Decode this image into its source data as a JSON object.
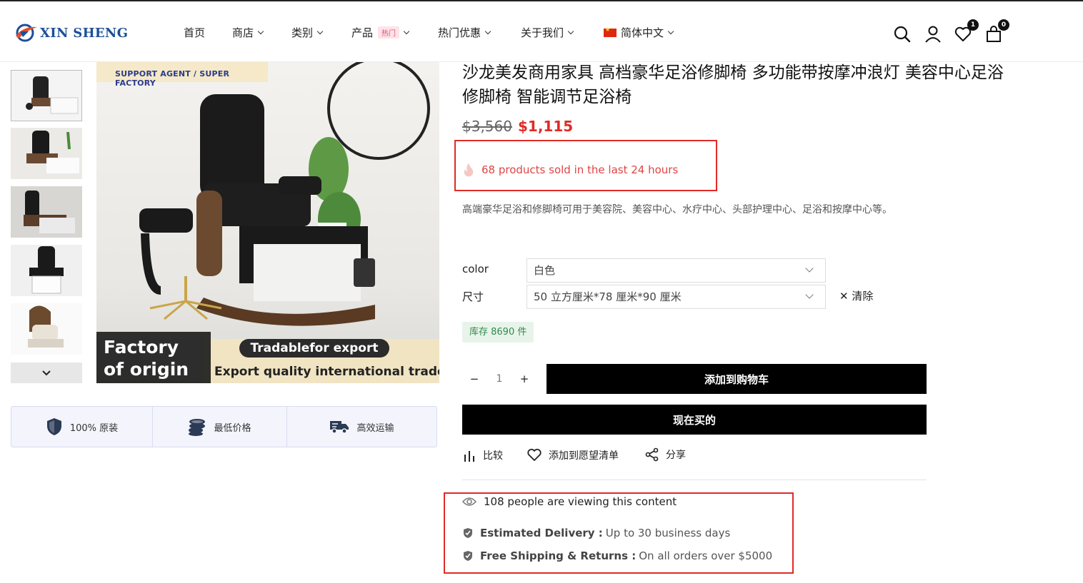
{
  "brand": {
    "name": "XIN SHENG"
  },
  "nav": [
    {
      "label": "首页",
      "has_dropdown": false
    },
    {
      "label": "商店",
      "has_dropdown": true
    },
    {
      "label": "类别",
      "has_dropdown": true
    },
    {
      "label": "产品",
      "has_dropdown": true,
      "badge": "热门"
    },
    {
      "label": "热门优惠",
      "has_dropdown": true
    },
    {
      "label": "关于我们",
      "has_dropdown": true
    },
    {
      "label": "简体中文",
      "has_dropdown": true,
      "icon": "china-flag-icon"
    }
  ],
  "header_icons": {
    "search": "search-icon",
    "account": "user-icon",
    "wishlist_count": "1",
    "cart_count": "0"
  },
  "gallery": {
    "banner_top": "SUPPORT AGENT / SUPER FACTORY",
    "factory_line1": "Factory",
    "factory_line2": "of origin",
    "trade_pill": "Tradablefor export",
    "trade_line": "Export quality international trade",
    "thumbnail_count": 5
  },
  "features": [
    {
      "label": "100% 原装",
      "icon": "shield-icon"
    },
    {
      "label": "最低价格",
      "icon": "coins-icon"
    },
    {
      "label": "高效运输",
      "icon": "truck-icon"
    }
  ],
  "product": {
    "title": "沙龙美发商用家具 高档豪华足浴修脚椅 多功能带按摩冲浪灯 美容中心足浴修脚椅 智能调节足浴椅",
    "price_old": "$3,560",
    "price_new": "$1,115",
    "sold_text": "68 products sold in the last 24 hours",
    "description": "高端豪华足浴和修脚椅可用于美容院、美容中心、水疗中心、头部护理中心、足浴和按摩中心等。",
    "color_label": "color",
    "color_value": "白色",
    "size_label": "尺寸",
    "size_value": "50 立方厘米*78 厘米*90 厘米",
    "clear_label": "清除",
    "stock": "库存 8690 件",
    "quantity": "1",
    "add_to_cart": "添加到购物车",
    "buy_now": "现在买的",
    "compare": "比较",
    "wishlist": "添加到愿望清单",
    "share": "分享"
  },
  "info": {
    "viewing": "108 people are viewing this content",
    "delivery_label": "Estimated Delivery :",
    "delivery_value": "Up to 30 business days",
    "shipping_label": "Free Shipping & Returns :",
    "shipping_value": "On all orders over $5000"
  },
  "colors": {
    "price_sale": "#e02b27",
    "highlight_box": "#e02b27",
    "brand_blue": "#1d4f99",
    "stock_green": "#2e8b4a"
  }
}
